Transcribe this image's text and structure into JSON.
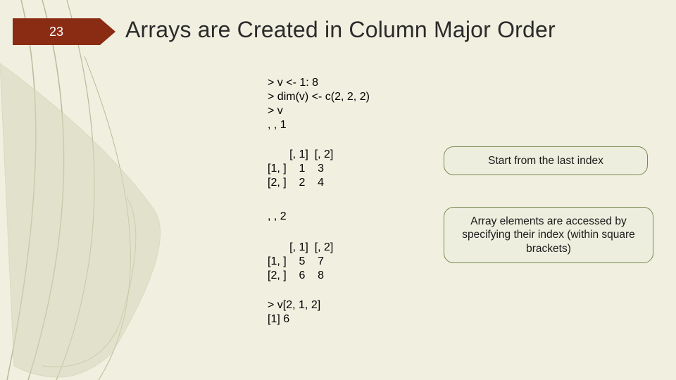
{
  "slide": {
    "page_number": "23",
    "title": "Arrays are Created in Column Major Order"
  },
  "code": {
    "top": "> v <- 1: 8\n> dim(v) <- c(2, 2, 2)\n> v\n, , 1",
    "table1": "       [, 1]  [, 2]\n[1, ]    1    3\n[2, ]    2    4",
    "sep2": ", , 2",
    "table2": "       [, 1]  [, 2]\n[1, ]    5    7\n[2, ]    6    8",
    "bottom": "> v[2, 1, 2]\n[1] 6"
  },
  "callouts": {
    "c1": "Start from the last index",
    "c2": "Array elements are accessed by specifying their index (within square brackets)"
  },
  "colors": {
    "accent": "#8a2b14",
    "bg": "#f0efe0",
    "leaf": "#c7c9a8",
    "callout_border": "#7a8a4f"
  }
}
